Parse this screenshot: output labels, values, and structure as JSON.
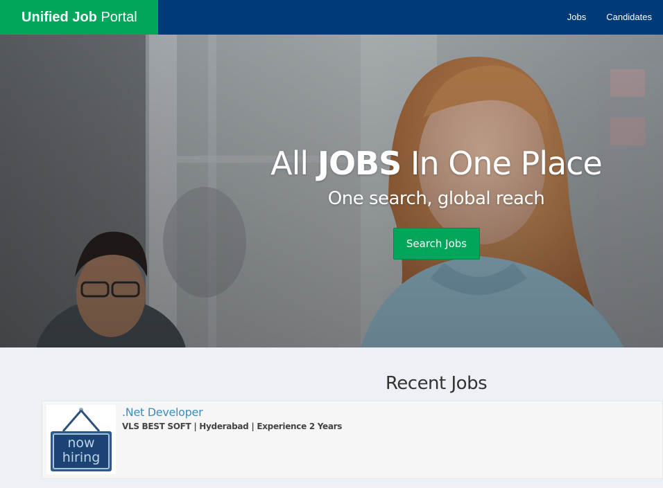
{
  "navbar": {
    "brand_bold": "Unified Job",
    "brand_rest": " Portal",
    "links": [
      "Jobs",
      "Candidates"
    ]
  },
  "hero": {
    "title_pre": "All ",
    "title_bold": "JOBS",
    "title_post": " In One Place",
    "subtitle": "One search, global reach",
    "button_label": "Search Jobs"
  },
  "recent_jobs": {
    "heading": "Recent Jobs",
    "items": [
      {
        "title": ".Net Developer",
        "company": "VLS BEST SOFT",
        "location": "Hyderabad",
        "experience": "Experience 2 Years",
        "logo_text_1": "now",
        "logo_text_2": "hiring"
      }
    ]
  },
  "colors": {
    "navbar": "#003a78",
    "brand": "#02a65a",
    "accent_green": "#02a65a",
    "link_blue": "#3c8dbc",
    "page_bg": "#edf0f5"
  }
}
